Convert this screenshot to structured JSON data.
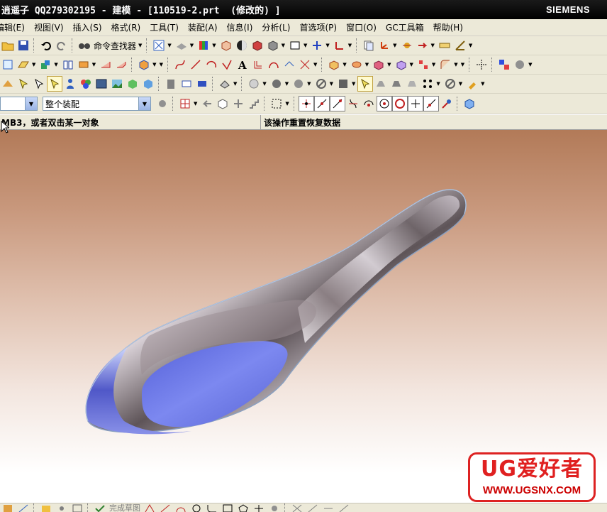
{
  "window": {
    "title": "逍遥子 QQ279302195 - 建模 - [110519-2.prt  (修改的) ]",
    "brand": "SIEMENS"
  },
  "menu": [
    "编辑(E)",
    "视图(V)",
    "插入(S)",
    "格式(R)",
    "工具(T)",
    "装配(A)",
    "信息(I)",
    "分析(L)",
    "首选项(P)",
    "窗口(O)",
    "GC工具箱",
    "帮助(H)"
  ],
  "toolbar1": {
    "command_finder_label": "命令查找器"
  },
  "selection": {
    "filter_value": "",
    "scope_value": "整个装配"
  },
  "status": {
    "left": "MB3，或者双击某一对象",
    "right": "该操作重置恢复数据"
  },
  "watermark": {
    "logo": "UG爱好者",
    "url": "WWW.UGSNX.COM"
  },
  "bottombar": {
    "sketch_label": "完成草图"
  },
  "colors": {
    "titlebar": "#000000",
    "ui_bg": "#ece9d8",
    "bowl_blue": "#7a86ee",
    "watermark_red": "#e02020"
  }
}
